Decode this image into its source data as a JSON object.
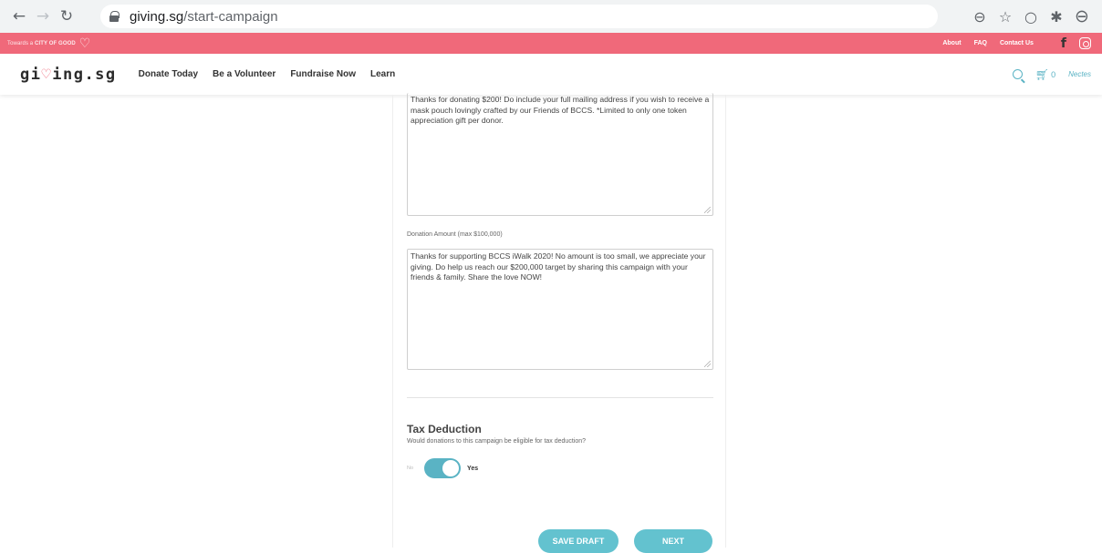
{
  "browser": {
    "url_domain": "giving.sg",
    "url_path": "/start-campaign"
  },
  "topbar": {
    "tagline_prefix": "Towards a",
    "tagline_bold": "CITY OF GOOD",
    "links": [
      "About",
      "FAQ",
      "Contact Us"
    ]
  },
  "nav": {
    "logo": "giving.sg",
    "links": [
      "Donate Today",
      "Be a Volunteer",
      "Fundraise Now",
      "Learn"
    ],
    "cart_count": "0",
    "user": "Nectes"
  },
  "form": {
    "message1": "Thanks for donating $200! Do include your full mailing address if you wish to receive a mask pouch lovingly crafted by our Friends of BCCS. *Limited to only one token appreciation gift per donor.",
    "donation_label": "Donation Amount (max $100,000)",
    "message2": "Thanks for supporting BCCS iWalk 2020! No amount is too small, we appreciate your giving. Do help us reach our $200,000 target by sharing this campaign with your friends & family. Share the love NOW!",
    "tax_title": "Tax Deduction",
    "tax_desc": "Would donations to this campaign be eligible for tax deduction?",
    "toggle_no": "No",
    "toggle_yes": "Yes",
    "toggle_on": true,
    "save_draft": "SAVE DRAFT",
    "next": "NEXT"
  },
  "colors": {
    "brand_pink": "#f0697a",
    "accent_teal": "#5ab3c4"
  }
}
